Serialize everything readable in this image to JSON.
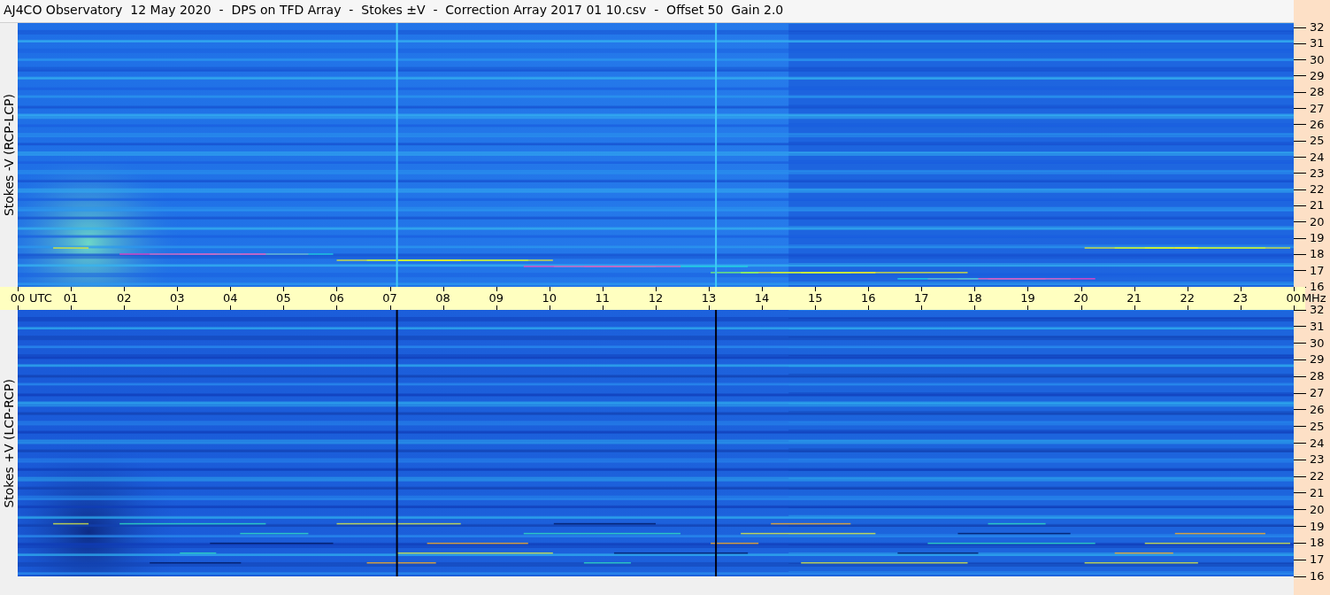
{
  "title": "AJ4CO Observatory  12 May 2020  -  DPS on TFD Array  -  Stokes ±V  -  Correction Array 2017 01 10.csv  -  Offset 50  Gain 2.0",
  "panels": [
    {
      "kind": "minus",
      "label": "Stokes -V (RCP-LCP)",
      "frequency_labels": [
        "32",
        "31",
        "30",
        "29",
        "28",
        "27",
        "26",
        "25",
        "24",
        "23",
        "22",
        "21",
        "20",
        "19",
        "18",
        "17",
        "16"
      ]
    },
    {
      "kind": "plus",
      "label": "Stokes +V (LCP-RCP)",
      "frequency_labels": [
        "32",
        "31",
        "30",
        "29",
        "28",
        "27",
        "26",
        "25",
        "24",
        "23",
        "22",
        "21",
        "20",
        "19",
        "18",
        "17",
        "16"
      ]
    }
  ],
  "time_axis": {
    "unit": "UTC",
    "frequency_unit": "MHz",
    "labels": [
      "00",
      "01",
      "02",
      "03",
      "04",
      "05",
      "06",
      "07",
      "08",
      "09",
      "10",
      "11",
      "12",
      "13",
      "14",
      "15",
      "16",
      "17",
      "18",
      "19",
      "20",
      "21",
      "22",
      "23",
      "00"
    ]
  }
}
